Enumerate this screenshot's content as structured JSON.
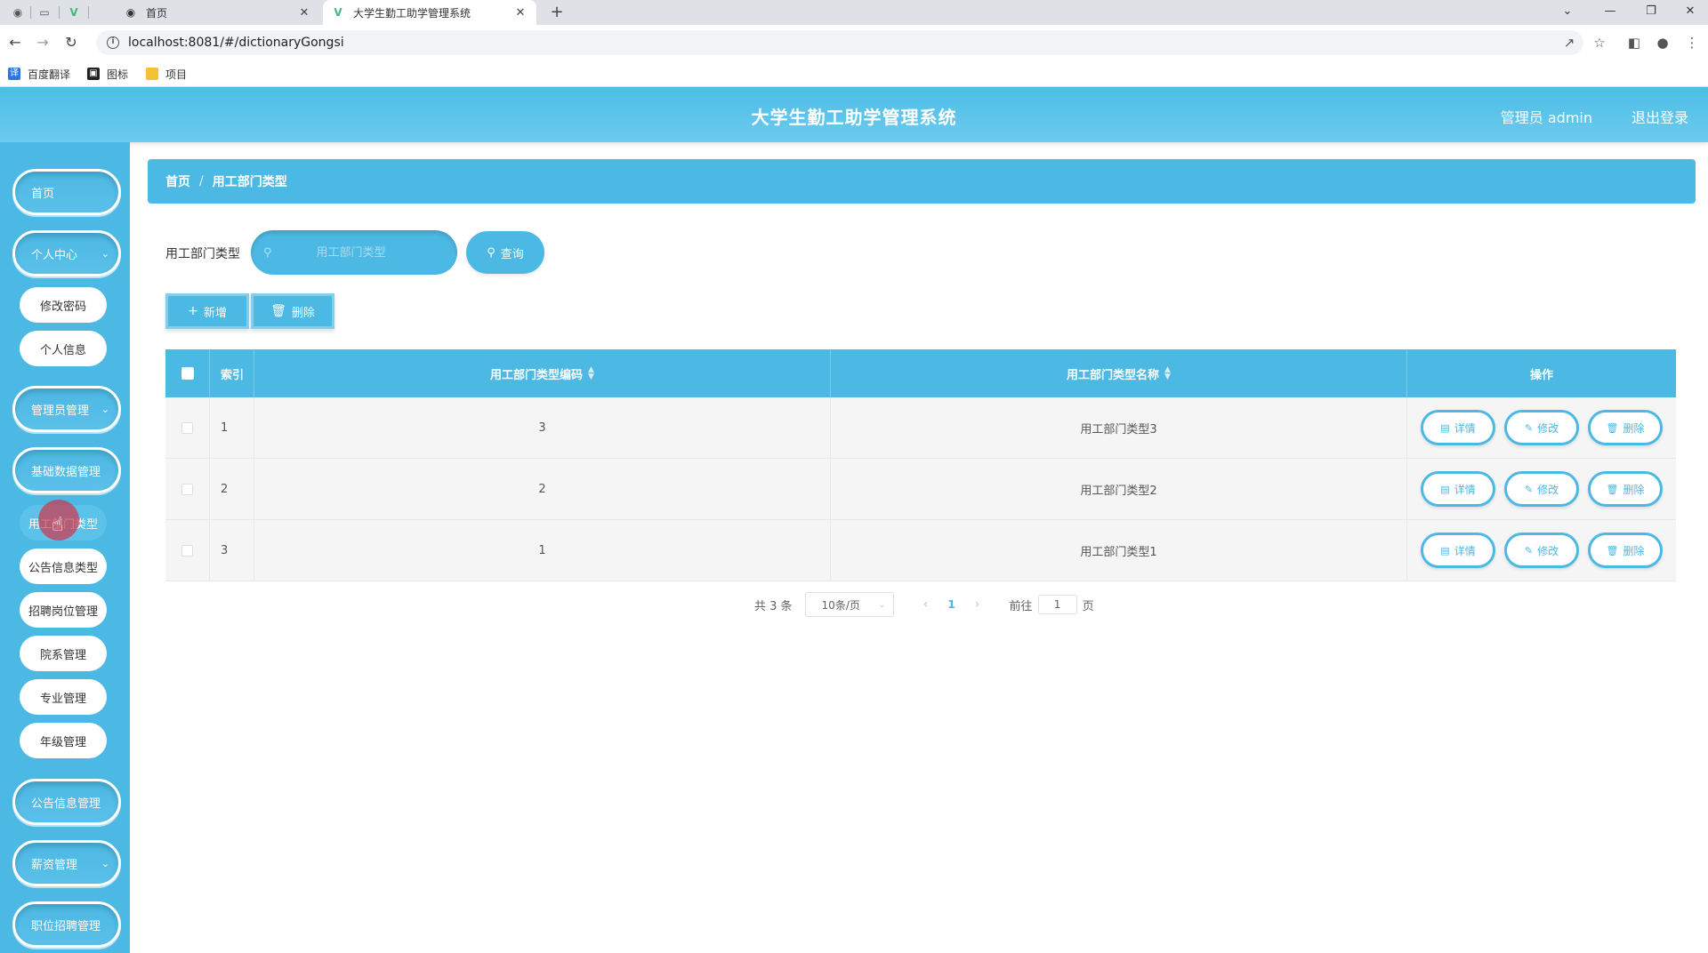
{
  "browser": {
    "tabs": [
      {
        "title": "首页",
        "active": false
      },
      {
        "title": "大学生勤工助学管理系统",
        "active": true
      }
    ],
    "url": "localhost:8081/#/dictionaryGongsi",
    "bookmarks": [
      "百度翻译",
      "图标",
      "项目"
    ]
  },
  "header": {
    "title": "大学生勤工助学管理系统",
    "user": "管理员 admin",
    "logout": "退出登录"
  },
  "sidebar": {
    "items": [
      {
        "label": "首页",
        "type": "menu"
      },
      {
        "label": "个人中心",
        "type": "menu",
        "expandable": true
      },
      {
        "label": "修改密码",
        "type": "sub"
      },
      {
        "label": "个人信息",
        "type": "sub"
      },
      {
        "label": "管理员管理",
        "type": "menu",
        "expandable": true
      },
      {
        "label": "基础数据管理",
        "type": "menu",
        "expandable": true
      },
      {
        "label": "用工部门类型",
        "type": "sub",
        "active": true
      },
      {
        "label": "公告信息类型",
        "type": "sub"
      },
      {
        "label": "招聘岗位管理",
        "type": "sub"
      },
      {
        "label": "院系管理",
        "type": "sub"
      },
      {
        "label": "专业管理",
        "type": "sub"
      },
      {
        "label": "年级管理",
        "type": "sub"
      },
      {
        "label": "公告信息管理",
        "type": "menu",
        "expandable": true
      },
      {
        "label": "薪资管理",
        "type": "menu",
        "expandable": true
      },
      {
        "label": "职位招聘管理",
        "type": "menu",
        "expandable": true
      }
    ]
  },
  "breadcrumb": {
    "home": "首页",
    "current": "用工部门类型"
  },
  "search": {
    "label": "用工部门类型",
    "placeholder": "用工部门类型",
    "button": "查询"
  },
  "actions": {
    "add": "新增",
    "delete": "删除"
  },
  "table": {
    "headers": {
      "index": "索引",
      "code": "用工部门类型编码",
      "name": "用工部门类型名称",
      "ops": "操作"
    },
    "rows": [
      {
        "index": "1",
        "code": "3",
        "name": "用工部门类型3"
      },
      {
        "index": "2",
        "code": "2",
        "name": "用工部门类型2"
      },
      {
        "index": "3",
        "code": "1",
        "name": "用工部门类型1"
      }
    ],
    "row_ops": {
      "detail": "详情",
      "edit": "修改",
      "delete": "删除"
    }
  },
  "pagination": {
    "total": "共 3 条",
    "page_size": "10条/页",
    "current_page": "1",
    "goto_label": "前往",
    "goto_value": "1",
    "page_suffix": "页"
  },
  "colors": {
    "primary": "#4cb8e4",
    "header": "#5cc4ea"
  }
}
